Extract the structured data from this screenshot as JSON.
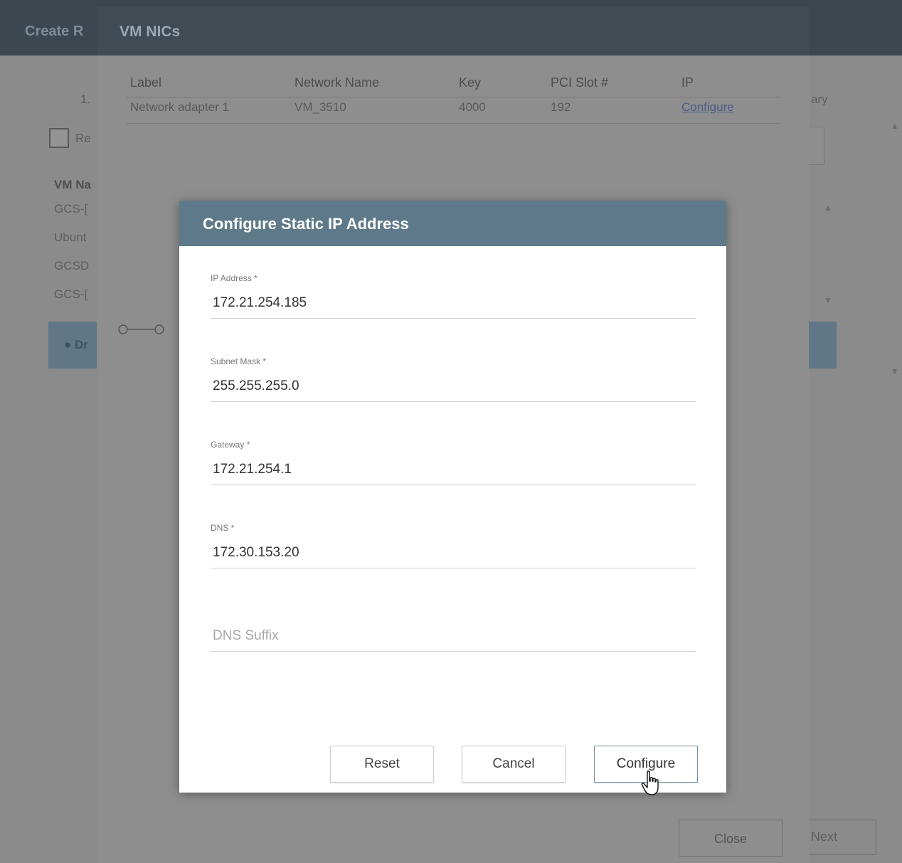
{
  "background": {
    "header_title": "Create R",
    "step_label": "1.",
    "checkbox_label": "Re",
    "vm_name_header": "VM Na",
    "vm_items": [
      "GCS-[",
      "Ubunt",
      "GCSD",
      "GCS-["
    ],
    "info_text": "Dr",
    "right_label": "ary",
    "next_label": "Next"
  },
  "nics_modal": {
    "title": "VM NICs",
    "columns": [
      "Label",
      "Network Name",
      "Key",
      "PCI Slot #",
      "IP"
    ],
    "rows": [
      {
        "label": "Network adapter 1",
        "network": "VM_3510",
        "key": "4000",
        "pci": "192",
        "ip": "Configure"
      }
    ],
    "close_label": "Close"
  },
  "dialog": {
    "title": "Configure Static IP Address",
    "fields": {
      "ip": {
        "label": "IP Address *",
        "value": "172.21.254.185"
      },
      "subnet": {
        "label": "Subnet Mask *",
        "value": "255.255.255.0"
      },
      "gateway": {
        "label": "Gateway *",
        "value": "172.21.254.1"
      },
      "dns": {
        "label": "DNS *",
        "value": "172.30.153.20"
      },
      "dns_suffix": {
        "placeholder": "DNS Suffix",
        "value": ""
      }
    },
    "buttons": {
      "reset": "Reset",
      "cancel": "Cancel",
      "configure": "Configure"
    }
  },
  "colors": {
    "dialog_header": "#5e7a8a",
    "nics_header": "#414b53",
    "link": "#4a5d86"
  }
}
